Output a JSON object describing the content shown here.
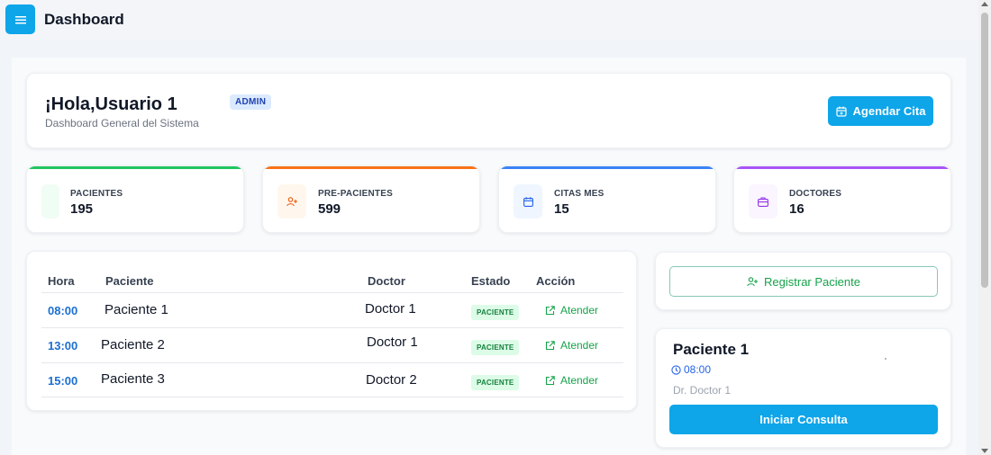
{
  "header": {
    "title": "Dashboard",
    "menu_icon": "menu-icon"
  },
  "welcome": {
    "greeting": "¡Hola,Usuario 1",
    "subtitle": "Dashboard General del Sistema",
    "role_badge": "ADMIN",
    "schedule_button": "Agendar Cita"
  },
  "stats": [
    {
      "label": "PACIENTES",
      "value": "195",
      "accent": "#22c55e",
      "icon": "users-icon"
    },
    {
      "label": "PRE-PACIENTES",
      "value": "599",
      "accent": "#f97316",
      "icon": "user-plus-icon"
    },
    {
      "label": "CITAS MES",
      "value": "15",
      "accent": "#3b82f6",
      "icon": "calendar-icon"
    },
    {
      "label": "DOCTORES",
      "value": "16",
      "accent": "#a855f7",
      "icon": "briefcase-medical-icon"
    }
  ],
  "table": {
    "headers": [
      "Hora",
      "Paciente",
      "Doctor",
      "Estado",
      "Acción"
    ],
    "rows": [
      {
        "time": "08:00",
        "patient": "Paciente 1",
        "doctor": "Doctor 1",
        "status": "PACIENTE",
        "action": "Atender"
      },
      {
        "time": "13:00",
        "patient": "Paciente 2",
        "doctor": "Doctor 1",
        "status": "PACIENTE",
        "action": "Atender"
      },
      {
        "time": "15:00",
        "patient": "Paciente 3",
        "doctor": "Doctor 2",
        "status": "PACIENTE",
        "action": "Atender"
      }
    ]
  },
  "register": {
    "button": "Registrar Paciente"
  },
  "next_appointment": {
    "patient": "Paciente 1",
    "time": "08:00",
    "doctor": "Dr. Doctor 1",
    "button": "Iniciar Consulta"
  },
  "colors": {
    "primary": "#0ea5e9",
    "success": "#16a34a",
    "link_blue": "#1d6fd1"
  }
}
